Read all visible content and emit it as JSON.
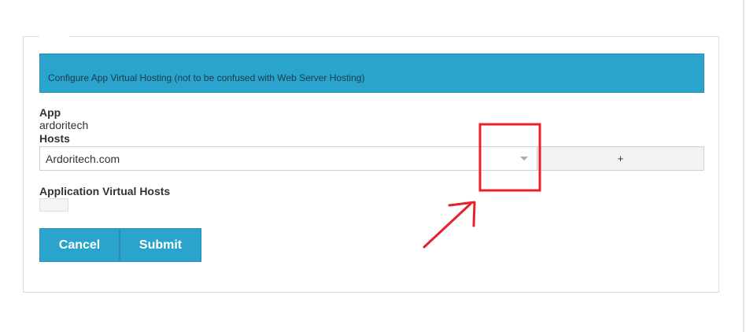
{
  "banner": {
    "text": "Configure App Virtual Hosting (not to be confused with Web Server Hosting)"
  },
  "app": {
    "label": "App",
    "value": "ardoritech"
  },
  "hosts": {
    "label": "Hosts",
    "selected": "Ardoritech.com",
    "add_label": "+"
  },
  "app_virtual_hosts": {
    "label": "Application Virtual Hosts"
  },
  "actions": {
    "cancel_label": "Cancel",
    "submit_label": "Submit"
  },
  "colors": {
    "accent": "#2aa4cc",
    "annotation": "#e8202a"
  }
}
